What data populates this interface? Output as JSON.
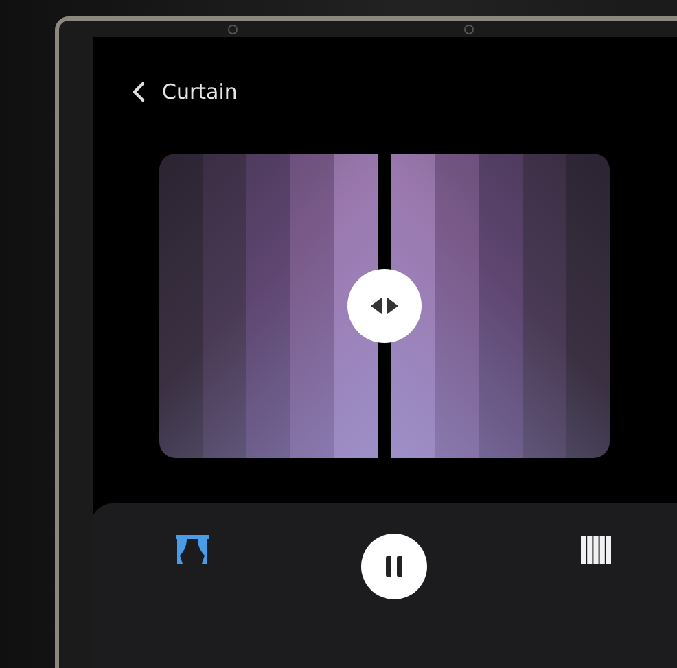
{
  "header": {
    "title": "Curtain"
  },
  "controls": [
    {
      "kind": "open",
      "selected": true
    },
    {
      "kind": "pause",
      "selected": false
    },
    {
      "kind": "close",
      "selected": false
    }
  ]
}
